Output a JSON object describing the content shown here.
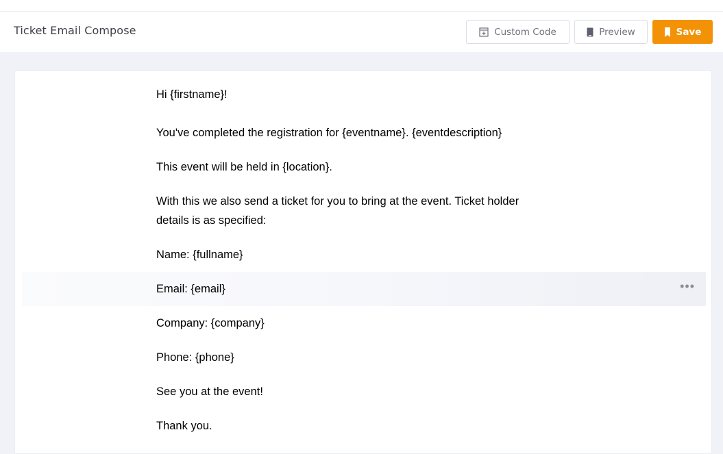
{
  "header": {
    "title": "Ticket Email Compose",
    "buttons": {
      "custom_code": "Custom Code",
      "preview": "Preview",
      "save": "Save"
    }
  },
  "colors": {
    "accent": "#f39207",
    "background": "#f1f2f7"
  },
  "email": {
    "lines": [
      "Hi {firstname}!",
      "You've completed the registration for {eventname}. {eventdescription}",
      "This event will be held in {location}.",
      "With this we also send a ticket for you to bring at the event. Ticket holder",
      "details is as specified:",
      "Name: {fullname}",
      "Email: {email}",
      "Company: {company}",
      "Phone: {phone}",
      "See you at the event!",
      "Thank you."
    ],
    "row_menu": "•••"
  }
}
